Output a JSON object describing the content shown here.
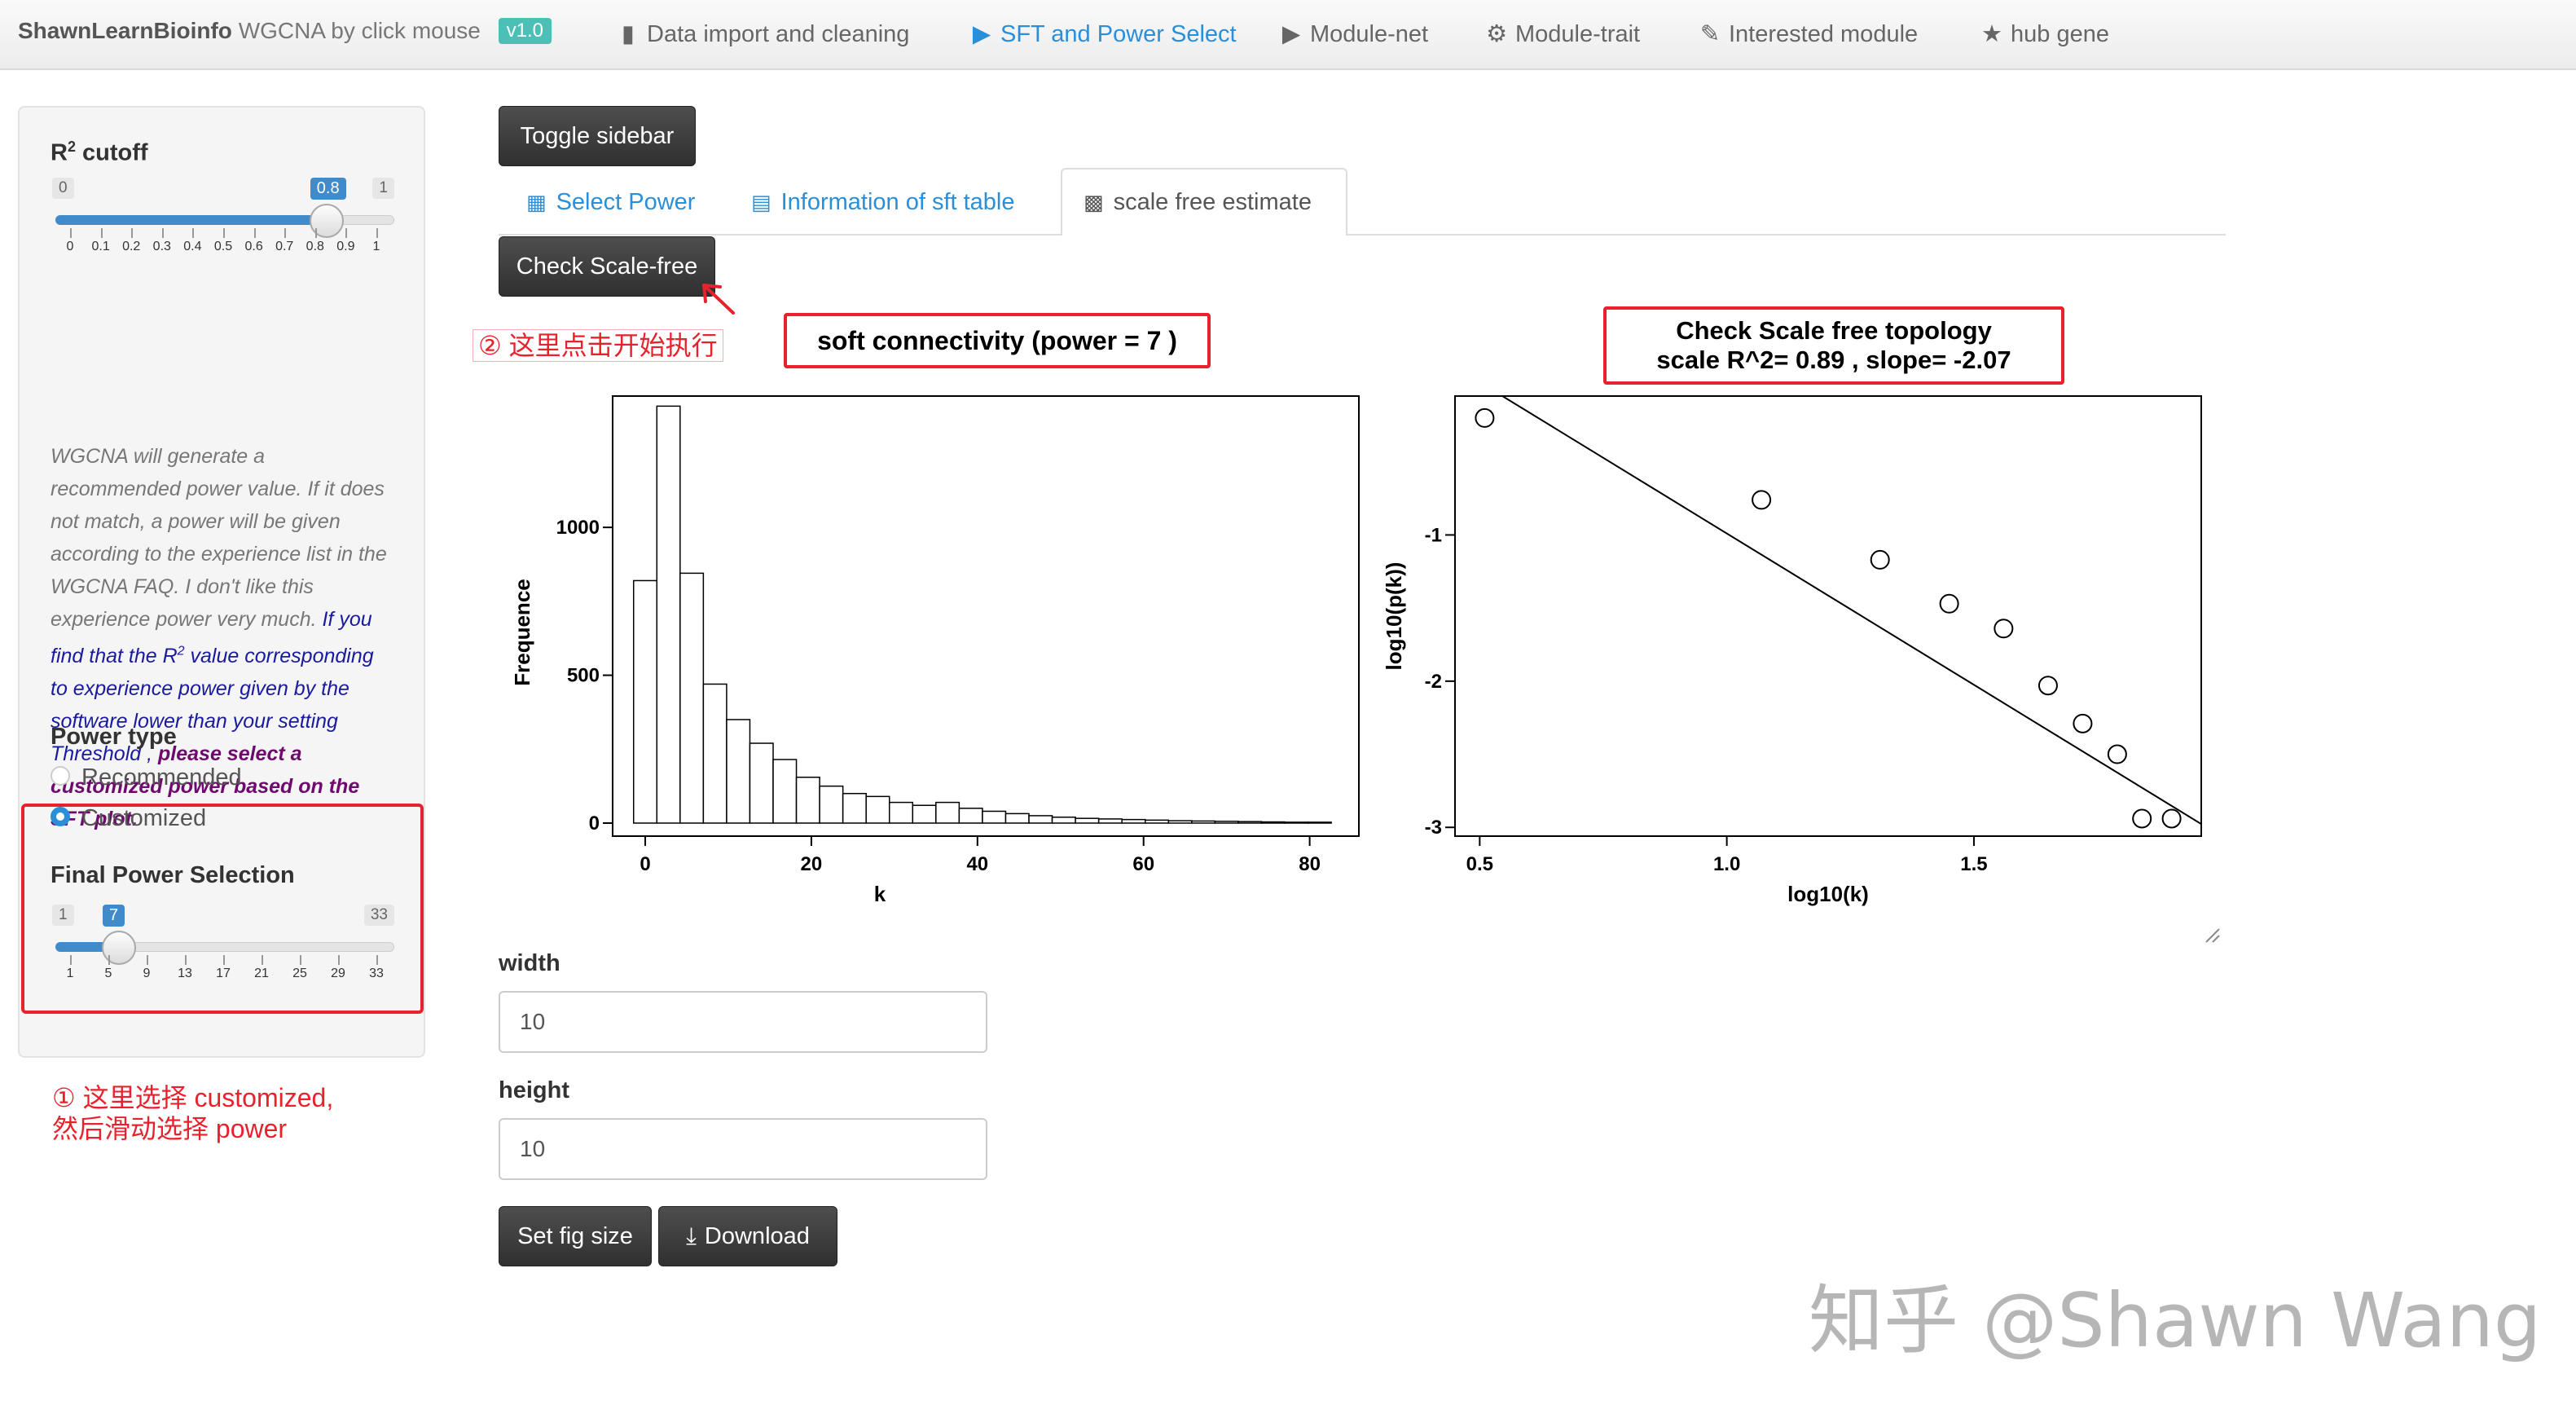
{
  "navbar": {
    "brand_bold": "ShawnLearnBioinfo",
    "brand_rest": "WGCNA by click mouse",
    "version": "v1.0",
    "items": [
      {
        "label": "Data import and cleaning",
        "icon": "file-icon"
      },
      {
        "label": "SFT and Power Select",
        "icon": "play-circle-icon",
        "active": true
      },
      {
        "label": "Module-net",
        "icon": "play-circle-icon"
      },
      {
        "label": "Module-trait",
        "icon": "gear-icon"
      },
      {
        "label": "Interested module",
        "icon": "brush-icon"
      },
      {
        "label": "hub gene",
        "icon": "star-icon"
      }
    ]
  },
  "sidebar": {
    "r2_label": "R",
    "r2_sup": "2",
    "r2_label_rest": " cutoff",
    "r2_slider": {
      "min": "0",
      "max": "1",
      "value": "0.8",
      "fraction": 0.8,
      "ticks": [
        "0",
        "0.1",
        "0.2",
        "0.3",
        "0.4",
        "0.5",
        "0.6",
        "0.7",
        "0.8",
        "0.9",
        "1"
      ]
    },
    "help_gray": "WGCNA will generate a recommended power value. If it does not match, a power will be given according to the experience list in the WGCNA FAQ. I don't like this experience power very much.",
    "help_blue_1": "If you find that the R",
    "help_blue_sup": "2",
    "help_blue_2": " value corresponding to experience power given by the software lower than your setting Threshold ,",
    "help_purple": "please select a customized power based on the SFT plot.",
    "power_type_label": "Power type",
    "radio_recommended": "Recommended",
    "radio_customized": "Customized",
    "final_power_label": "Final Power Selection",
    "power_slider": {
      "min": "1",
      "max": "33",
      "value": "7",
      "fraction": 0.1875,
      "ticks": [
        "1",
        "5",
        "9",
        "13",
        "17",
        "21",
        "25",
        "29",
        "33"
      ]
    }
  },
  "annotations": {
    "step1_line1": "① 这里选择 customized,",
    "step1_line2": "然后滑动选择 power",
    "step2": "② 这里点击开始执行"
  },
  "main": {
    "toggle_sidebar": "Toggle sidebar",
    "tabs": [
      {
        "label": "Select Power",
        "icon": "grid-icon"
      },
      {
        "label": "Information of sft table",
        "icon": "table-icon"
      },
      {
        "label": "scale free estimate",
        "icon": "bar-chart-icon",
        "active": true
      }
    ],
    "check_button": "Check Scale-free",
    "hist_title": "soft connectivity (power =  7 )",
    "scatter_title_1": "Check Scale free topology",
    "scatter_title_2": "scale R^2= 0.89 , slope= -2.07",
    "width_label": "width",
    "width_value": "10",
    "height_label": "height",
    "height_value": "10",
    "set_fig_size": "Set fig size",
    "download": "Download"
  },
  "watermark": "知乎 @Shawn Wang",
  "chart_data": [
    {
      "type": "bar",
      "xlabel": "k",
      "ylabel": "Frequence",
      "xticks": [
        "0",
        "20",
        "40",
        "60",
        "80"
      ],
      "yticks": [
        "0",
        "500",
        "1000"
      ],
      "xlim": [
        -4,
        82
      ],
      "ylim": [
        0,
        1400
      ],
      "bin_width": 2.8,
      "bin_start": -1.4,
      "values": [
        820,
        1410,
        845,
        470,
        350,
        270,
        215,
        155,
        125,
        100,
        90,
        70,
        60,
        70,
        50,
        40,
        32,
        25,
        20,
        16,
        14,
        12,
        10,
        8,
        7,
        6,
        5,
        4,
        3,
        3
      ]
    },
    {
      "type": "scatter",
      "xlabel": "log10(k)",
      "ylabel": "log10(p(k))",
      "xticks": [
        "0.5",
        "1.0",
        "1.5"
      ],
      "yticks": [
        "-3",
        "-2",
        "-1"
      ],
      "xlim": [
        0.45,
        1.96
      ],
      "ylim": [
        -3.06,
        -0.05
      ],
      "points": [
        [
          0.51,
          -0.2
        ],
        [
          1.07,
          -0.76
        ],
        [
          1.31,
          -1.17
        ],
        [
          1.45,
          -1.47
        ],
        [
          1.56,
          -1.64
        ],
        [
          1.65,
          -2.03
        ],
        [
          1.72,
          -2.29
        ],
        [
          1.79,
          -2.5
        ],
        [
          1.84,
          -2.94
        ],
        [
          1.9,
          -2.94
        ]
      ],
      "fit": {
        "slope": -2.07,
        "intercept": 1.08
      }
    }
  ]
}
